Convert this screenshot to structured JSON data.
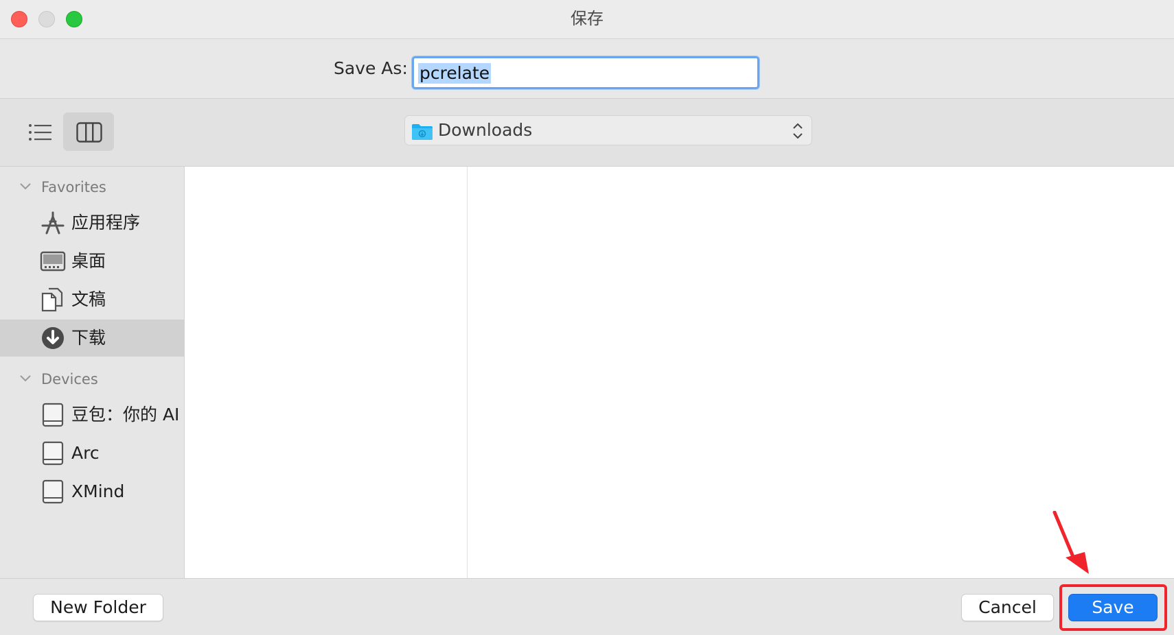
{
  "window": {
    "title": "保存"
  },
  "save_as": {
    "label": "Save As:",
    "value": "pcrelate"
  },
  "toolbar": {
    "list_view_icon": "list-icon",
    "column_view_icon": "columns-icon",
    "location": "Downloads"
  },
  "sidebar": {
    "favorites_header": "Favorites",
    "favorites": [
      {
        "label": "应用程序",
        "icon": "applications-icon"
      },
      {
        "label": "桌面",
        "icon": "desktop-icon"
      },
      {
        "label": "文稿",
        "icon": "documents-icon"
      },
      {
        "label": "下载",
        "icon": "downloads-icon",
        "selected": true
      }
    ],
    "devices_header": "Devices",
    "devices": [
      {
        "label": "豆包：你的 AI",
        "icon": "disk-icon"
      },
      {
        "label": "Arc",
        "icon": "disk-icon"
      },
      {
        "label": "XMind",
        "icon": "disk-icon"
      }
    ]
  },
  "footer": {
    "new_folder": "New Folder",
    "cancel": "Cancel",
    "save": "Save"
  },
  "colors": {
    "accent": "#1c7cf4",
    "annotation": "#f0242b"
  }
}
